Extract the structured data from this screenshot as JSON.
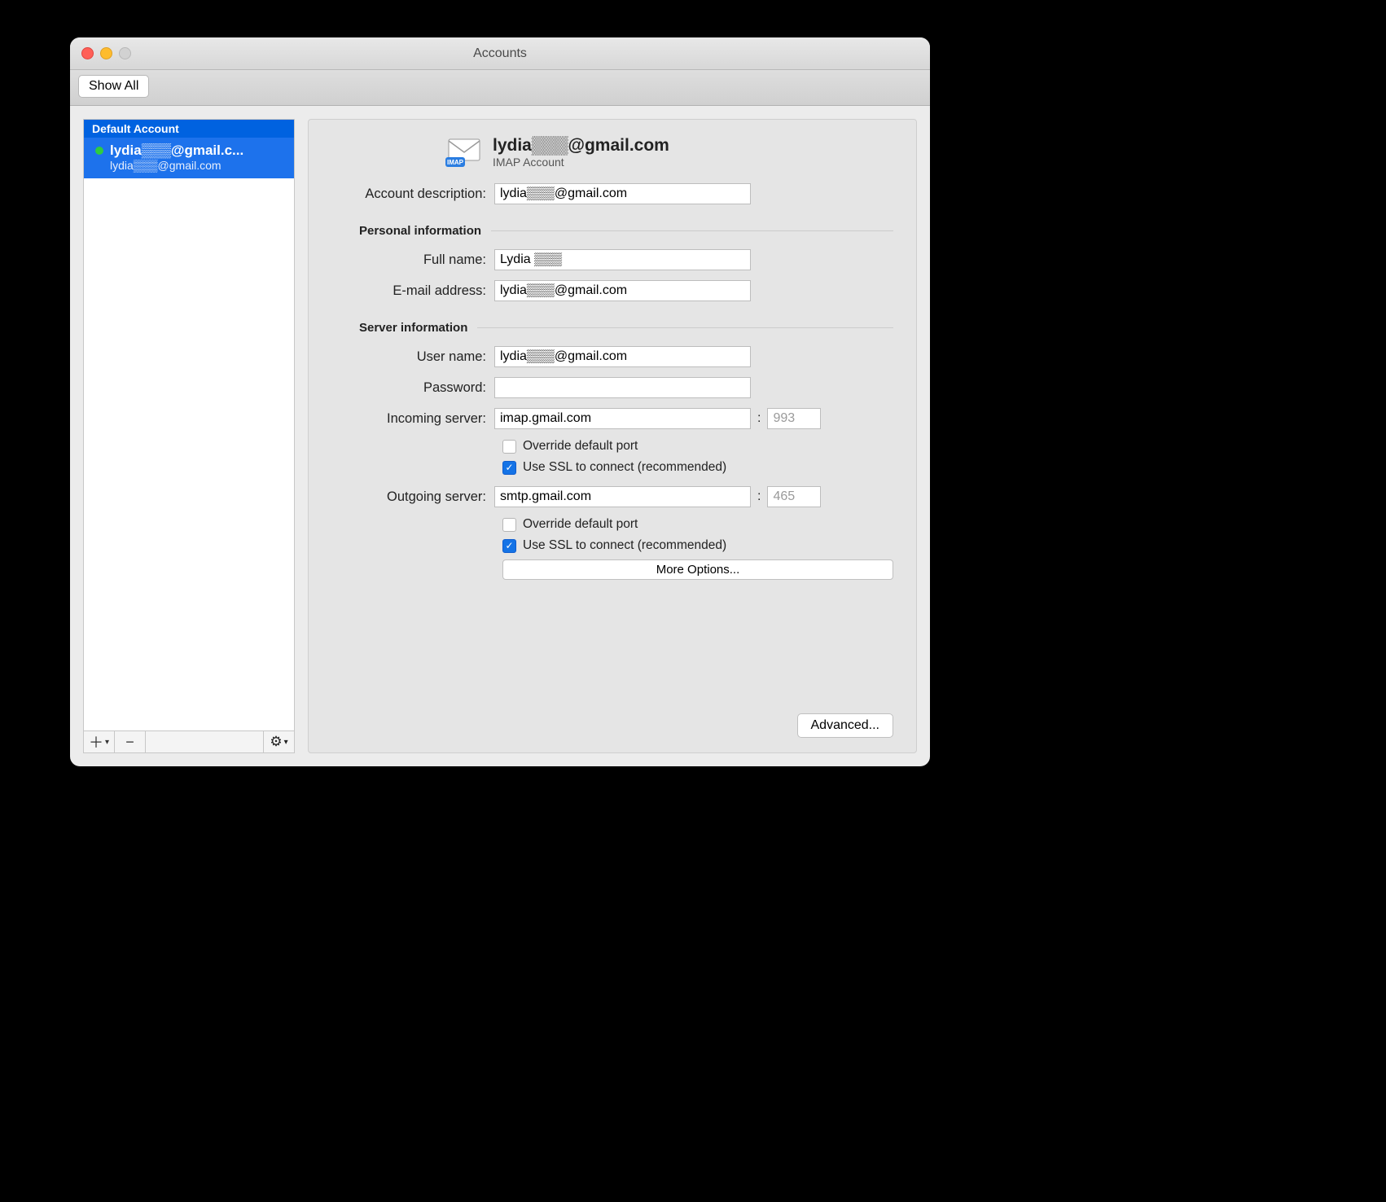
{
  "window": {
    "title": "Accounts",
    "show_all": "Show All"
  },
  "sidebar": {
    "header": "Default Account",
    "item": {
      "name": "lydia▒▒▒@gmail.c...",
      "sub": "lydia▒▒▒@gmail.com"
    }
  },
  "header": {
    "title": "lydia▒▒▒@gmail.com",
    "subtitle": "IMAP Account"
  },
  "labels": {
    "desc": "Account description:",
    "personal": "Personal information",
    "fullname": "Full name:",
    "email": "E-mail address:",
    "server": "Server information",
    "user": "User name:",
    "password": "Password:",
    "incoming": "Incoming server:",
    "outgoing": "Outgoing server:",
    "override": "Override default port",
    "ssl": "Use SSL to connect (recommended)",
    "more": "More Options...",
    "advanced": "Advanced..."
  },
  "values": {
    "desc": "lydia▒▒▒@gmail.com",
    "fullname": "Lydia ▒▒▒",
    "email": "lydia▒▒▒@gmail.com",
    "user": "lydia▒▒▒@gmail.com",
    "password": "",
    "incoming": "imap.gmail.com",
    "in_port": "993",
    "outgoing": "smtp.gmail.com",
    "out_port": "465"
  },
  "checks": {
    "in_override": false,
    "in_ssl": true,
    "out_override": false,
    "out_ssl": true
  }
}
